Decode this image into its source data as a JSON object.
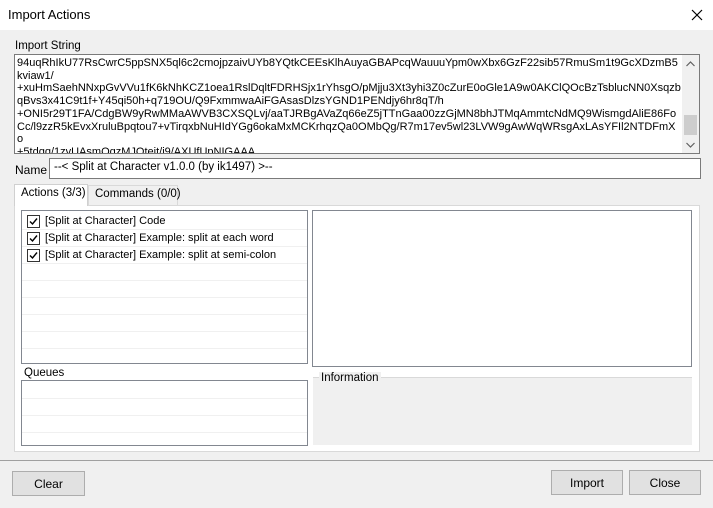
{
  "window": {
    "title": "Import Actions"
  },
  "import": {
    "label": "Import String",
    "value": "94uqRhIkU77RsCwrC5ppSNX5ql6c2cmojpzaivUYb8YQtkCEEsKlhAuyaGBAPcqWauuuYpm0wXbx6GzF22sib57RmuSm1t9GcXDzmB5kviaw1/\n+xuHmSaehNNxpGvVVu1fK6kNhKCZ1oea1RslDqltFDRHSjx1rYhsgO/pMjju3Xt3yhi3Z0cZurE0oGle1A9w0AKClQOcBzTsblucNN0XsqzbqBvs3x41C9t1f+Y45qi50h+q719OU/Q9FxmmwaAiFGAsasDlzsYGND1PENdjy6hr8qT/h\n+ONI5r29T1FA/CdgBW9yRwMMaAWVB3CXSQLvj/aaTJRBgAVaZq66eZ5jTTnGaa00zzGjMN8bhJTMqAmmtcNdMQ9WismgdAliE86FoCc/l9zzR5kEvxXruluBpqtou7+vTirqxbNuHIdYGg6okaMxMCKrhqzQa0OMbQg/R7m17ev5wl23LVW9gAwWqWRsgAxLAsYFIl2NTDFmXo\n+5tdqq/1zvUAsmOqzMJQtejt/i9/AXUfUpNIGAAA"
  },
  "name": {
    "label": "Name",
    "value": "--< Split at Character v1.0.0 (by ik1497) >--"
  },
  "tabs": {
    "actions": "Actions (3/3)",
    "commands": "Commands (0/0)"
  },
  "actions": [
    {
      "label": "[Split at Character] Code",
      "checked": true
    },
    {
      "label": "[Split at Character] Example: split at each word",
      "checked": true
    },
    {
      "label": "[Split at Character] Example: split at semi-colon",
      "checked": true
    }
  ],
  "queues": {
    "label": "Queues"
  },
  "information": {
    "label": "Information"
  },
  "buttons": {
    "clear": "Clear",
    "import": "Import",
    "close": "Close"
  },
  "icons": {
    "close": "close-icon",
    "scroll_up": "chevron-up-icon",
    "scroll_down": "chevron-down-icon",
    "check": "checkmark-icon"
  }
}
